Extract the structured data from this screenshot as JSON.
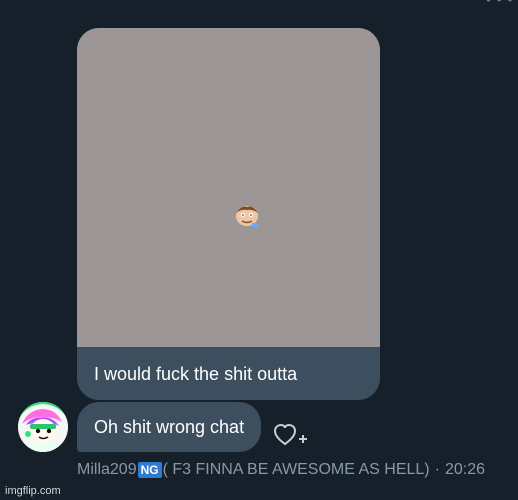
{
  "top_edge": {
    "icon": "ellipsis-icon",
    "glyph": "• • •"
  },
  "media_message": {
    "caption": "I would fuck the shit outta",
    "image_icon": "tiny-cartoon-face-image",
    "image_background": "#9c9696"
  },
  "message": {
    "text": "Oh shit wrong chat",
    "bubble_color": "#3d4e5e"
  },
  "reaction": {
    "icon": "heart-plus-icon"
  },
  "meta": {
    "sender_name": "Milla209",
    "badge_text": "NG",
    "sender_rest": "( F3 FINNA BE AWESOME AS HELL)",
    "separator": "·",
    "time": "20:26"
  },
  "watermark": {
    "text": "imgflip.com"
  },
  "colors": {
    "background": "#15202b",
    "bubble": "#3d4e5e",
    "meta_text": "#8899a6",
    "badge": "#2f7bd3"
  }
}
